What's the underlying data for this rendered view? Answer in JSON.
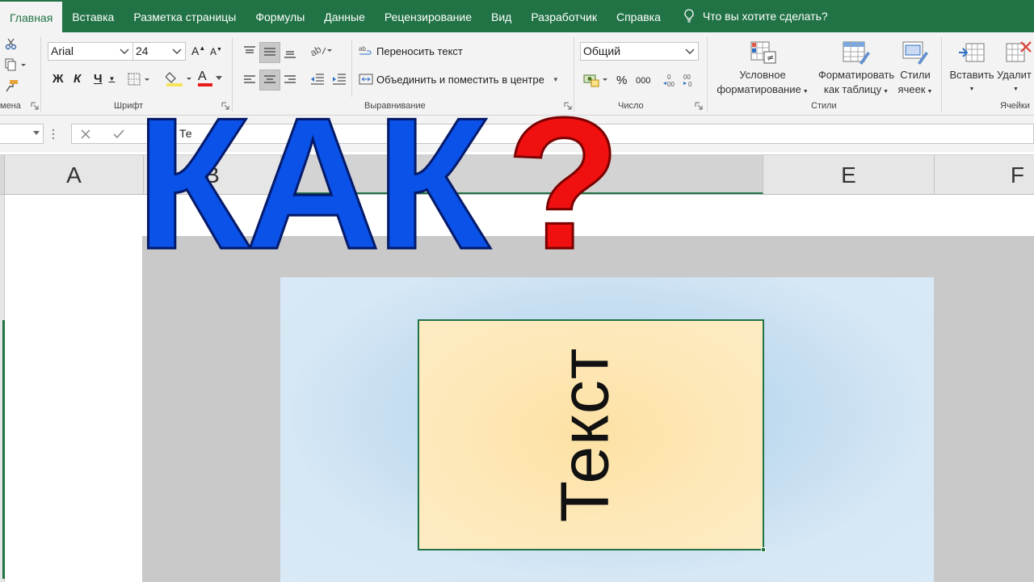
{
  "tabs": [
    "Главная",
    "Вставка",
    "Разметка страницы",
    "Формулы",
    "Данные",
    "Рецензирование",
    "Вид",
    "Разработчик",
    "Справка"
  ],
  "tell_me": "Что вы хотите сделать?",
  "ribbon": {
    "clipboard_label": "мена",
    "font": {
      "name": "Arial",
      "size": "24",
      "bold": "Ж",
      "italic": "К",
      "underline": "Ч",
      "grow": "A",
      "shrink": "A",
      "color_letter": "A",
      "label": "Шрифт"
    },
    "alignment": {
      "wrap": "Переносить текст",
      "merge": "Объединить и поместить в центре",
      "label": "Выравнивание"
    },
    "number": {
      "format": "Общий",
      "percent": "%",
      "thousands": "000",
      "label": "Число"
    },
    "styles": {
      "conditional_1": "Условное",
      "conditional_2": "форматирование",
      "table_1": "Форматировать",
      "table_2": "как таблицу",
      "cell_1": "Стили",
      "cell_2": "ячеек",
      "label": "Стили"
    },
    "cells": {
      "insert": "Вставить",
      "delete": "Удалит",
      "label": "Ячейки"
    }
  },
  "formula_bar": {
    "value": "Те"
  },
  "columns": [
    "A",
    "B",
    "E",
    "F"
  ],
  "cell_text": "Текст",
  "title": {
    "word": "КАК",
    "mark": "?"
  },
  "colors": {
    "excel_green": "#217346",
    "title_blue": "#0a52e8",
    "title_red": "#f01010"
  }
}
